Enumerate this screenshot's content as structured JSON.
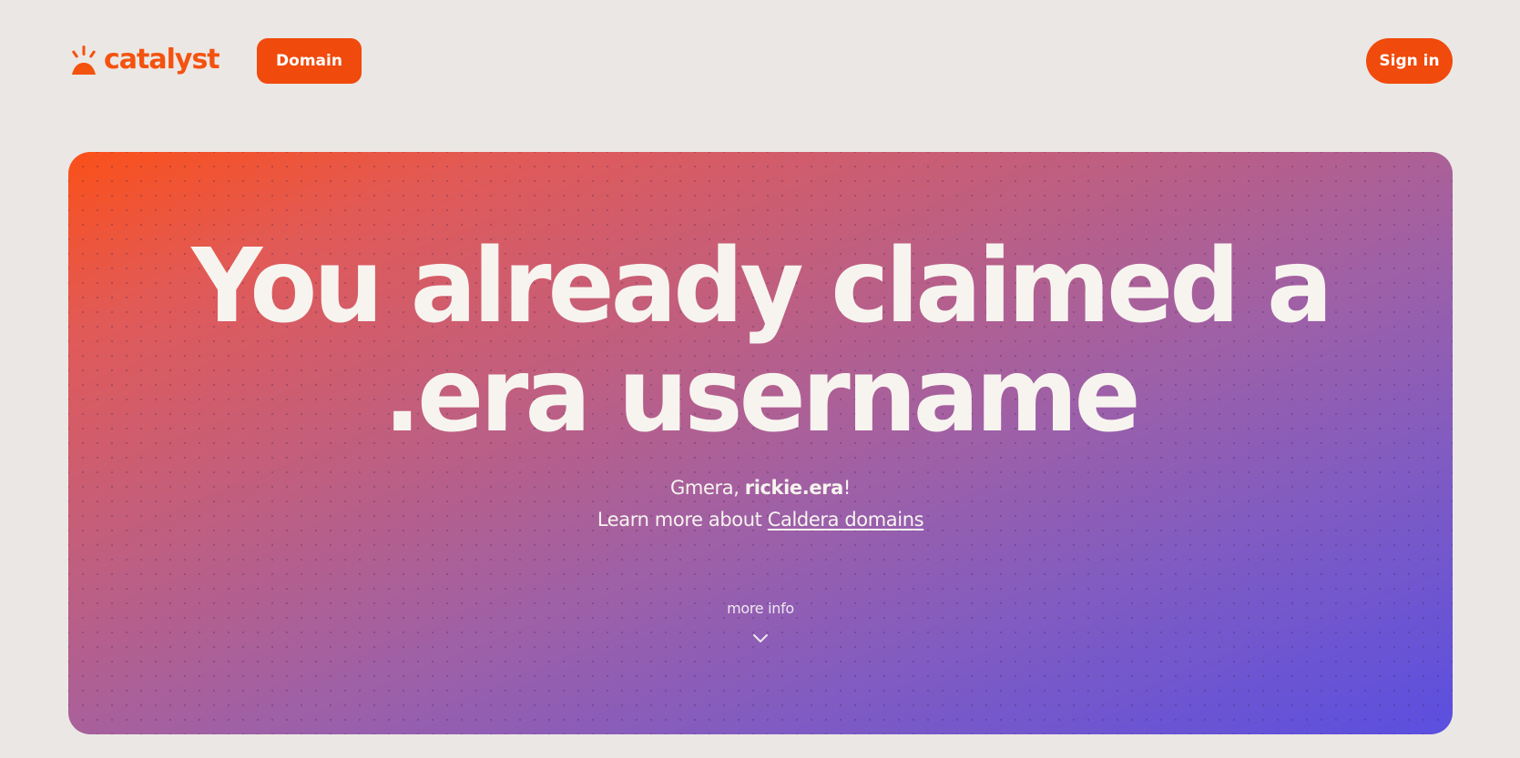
{
  "header": {
    "logo_text": "catalyst",
    "domain_button": "Domain",
    "signin_button": "Sign in"
  },
  "hero": {
    "title_line1": "You already claimed a",
    "title_line2": ".era username",
    "greeting_prefix": "Gmera, ",
    "username": "rickie.era",
    "greeting_suffix": "!",
    "learn_more_prefix": "Learn more about ",
    "learn_more_link": "Caldera domains",
    "more_info": "more info"
  },
  "colors": {
    "brand_orange": "#f04a0c",
    "page_background": "#ebe7e4",
    "gradient_start": "#fb5019",
    "gradient_end": "#5a4fe0",
    "hero_text": "#f7f4ef"
  },
  "icons": {
    "logo": "catalyst-logo-icon",
    "more_info": "chevron-down-icon"
  }
}
